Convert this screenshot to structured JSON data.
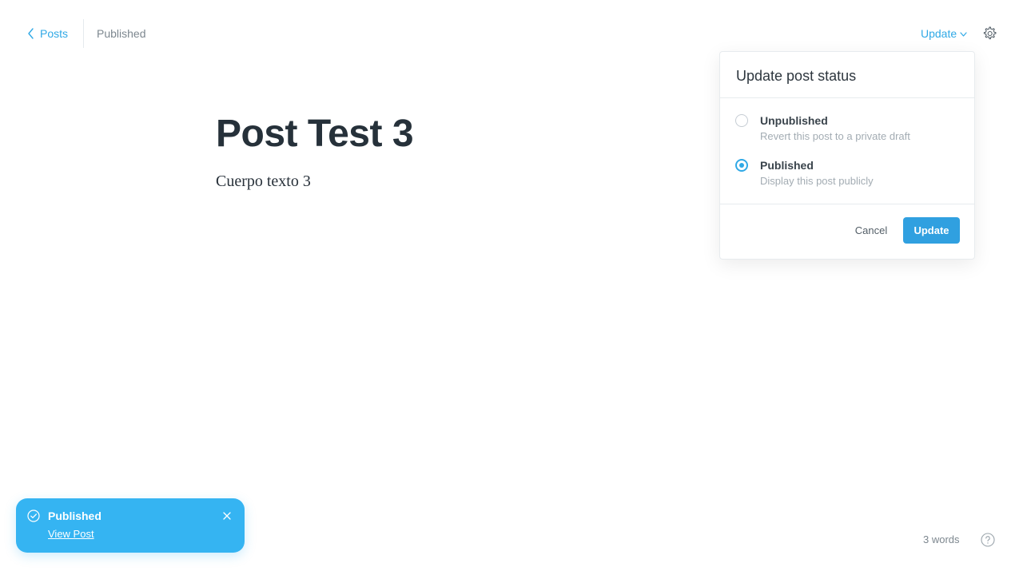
{
  "header": {
    "back_label": "Posts",
    "status": "Published",
    "update_label": "Update"
  },
  "editor": {
    "title": "Post Test 3",
    "body": "Cuerpo texto 3"
  },
  "popover": {
    "title": "Update post status",
    "options": [
      {
        "label": "Unpublished",
        "description": "Revert this post to a private draft",
        "selected": false
      },
      {
        "label": "Published",
        "description": "Display this post publicly",
        "selected": true
      }
    ],
    "cancel_label": "Cancel",
    "update_label": "Update"
  },
  "toast": {
    "title": "Published",
    "link": "View Post"
  },
  "footer": {
    "word_count": "3 words"
  },
  "colors": {
    "accent": "#30a9e6",
    "toast_bg": "#35b4f2",
    "primary_button": "#30a0e0"
  },
  "icons": {
    "back": "chevron-left-icon",
    "dropdown": "chevron-down-icon",
    "settings": "gear-icon",
    "toast_status": "check-circle-icon",
    "toast_close": "close-icon",
    "help": "question-circle-icon"
  }
}
